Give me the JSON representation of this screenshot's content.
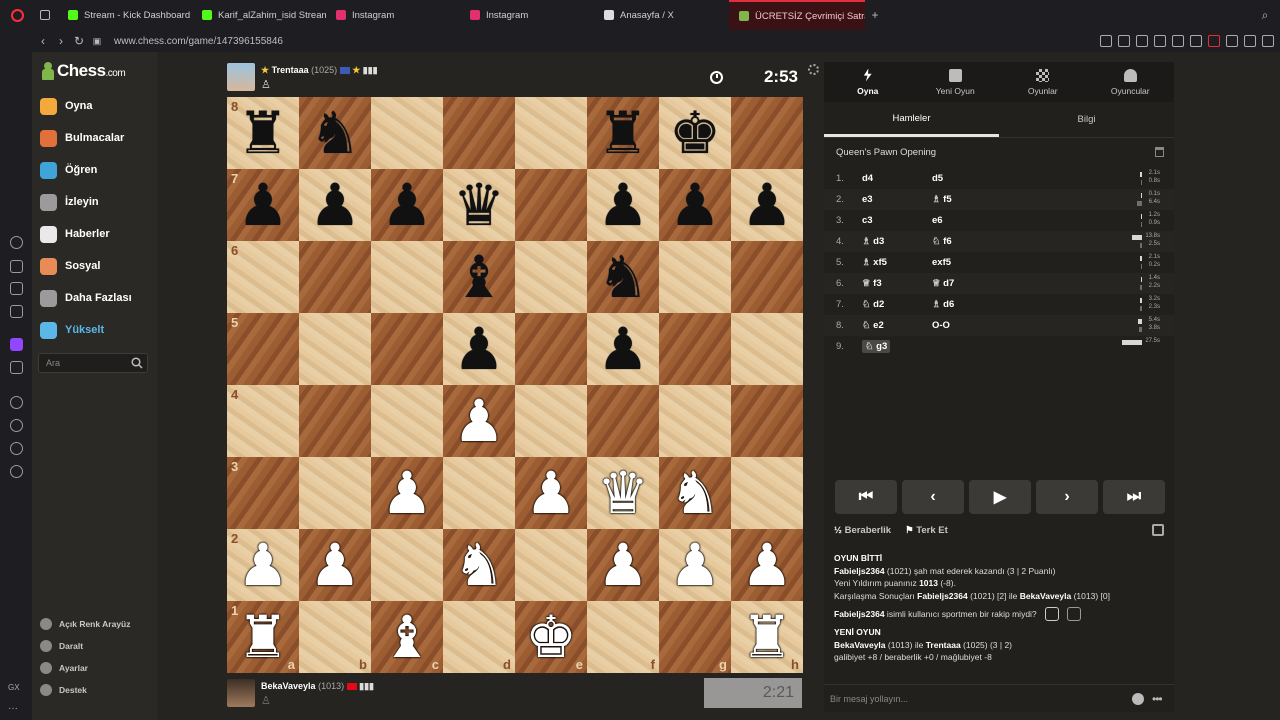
{
  "browser": {
    "tabs": [
      {
        "label": "Stream - Kick Dashboard",
        "color": "#53fc18"
      },
      {
        "label": "Karif_alZahim_isid Stream",
        "color": "#53fc18"
      },
      {
        "label": "Instagram",
        "color": "#e1306c"
      },
      {
        "label": "Instagram",
        "color": "#e1306c"
      },
      {
        "label": "Anasayfa / X",
        "color": "#dddddd"
      },
      {
        "label": "ÜCRETSİZ Çevrimiçi Satranç",
        "color": "#81b64c"
      }
    ],
    "url": "www.chess.com/game/147396155846",
    "gx_label": "GX"
  },
  "sidebar": {
    "logo": "Chess",
    "logo_suffix": ".com",
    "items": [
      {
        "label": "Oyna",
        "color": "#f3a93c"
      },
      {
        "label": "Bulmacalar",
        "color": "#e2703a"
      },
      {
        "label": "Öğren",
        "color": "#3fa4d8"
      },
      {
        "label": "İzleyin",
        "color": "#9b9b9b"
      },
      {
        "label": "Haberler",
        "color": "#e9e9e9"
      },
      {
        "label": "Sosyal",
        "color": "#e98b56"
      },
      {
        "label": "Daha Fazlası",
        "color": "#9b9b9b"
      },
      {
        "label": "Yükselt",
        "color": "#5bb7e8"
      }
    ],
    "search_placeholder": "Ara",
    "bottom": [
      "Açık Renk Arayüz",
      "Daralt",
      "Ayarlar",
      "Destek"
    ]
  },
  "game": {
    "top_player": {
      "name": "Trentaaa",
      "rating": "(1025)"
    },
    "bottom_player": {
      "name": "BekaVaveyla",
      "rating": "(1013)"
    },
    "top_clock": "2:53",
    "bottom_clock": "2:21",
    "ranks": [
      "8",
      "7",
      "6",
      "5",
      "4",
      "3",
      "2",
      "1"
    ],
    "files": [
      "a",
      "b",
      "c",
      "d",
      "e",
      "f",
      "g",
      "h"
    ],
    "board": [
      [
        "br",
        "bn",
        "",
        "",
        "",
        "br",
        "bk",
        ""
      ],
      [
        "bp",
        "bp",
        "bp",
        "bq",
        "",
        "bp",
        "bp",
        "bp"
      ],
      [
        "",
        "",
        "",
        "bb",
        "",
        "bn",
        "",
        ""
      ],
      [
        "",
        "",
        "",
        "bp",
        "",
        "bp",
        "",
        ""
      ],
      [
        "",
        "",
        "",
        "wp",
        "",
        "",
        "",
        ""
      ],
      [
        "",
        "",
        "wp",
        "",
        "wp",
        "wq",
        "wn",
        ""
      ],
      [
        "wp",
        "wp",
        "",
        "wn",
        "",
        "wp",
        "wp",
        "wp"
      ],
      [
        "wr",
        "",
        "wb",
        "",
        "wk",
        "",
        "",
        "wr"
      ]
    ]
  },
  "panel": {
    "tabs": [
      "Oyna",
      "Yeni Oyun",
      "Oyunlar",
      "Oyuncular"
    ],
    "subtabs": [
      "Hamleler",
      "Bilgi"
    ],
    "opening": "Queen's Pawn Opening",
    "moves": [
      {
        "n": "1.",
        "w": "d4",
        "b": "d5",
        "wt": "2.1s",
        "bt": "0.8s",
        "wv": 0.08,
        "bv": 0.03
      },
      {
        "n": "2.",
        "w": "e3",
        "b": "f5",
        "wt": "0.1s",
        "bt": "6.4s",
        "wv": 0.01,
        "bv": 0.23
      },
      {
        "n": "3.",
        "w": "c3",
        "b": "e6",
        "wt": "1.2s",
        "bt": "0.9s",
        "wv": 0.04,
        "bv": 0.03
      },
      {
        "n": "4.",
        "w": "d3",
        "b": "f6",
        "wt": "13.8s",
        "bt": "2.5s",
        "wv": 0.5,
        "bv": 0.09
      },
      {
        "n": "5.",
        "w": "xf5",
        "b": "exf5",
        "wt": "2.1s",
        "bt": "0.2s",
        "wv": 0.08,
        "bv": 0.01
      },
      {
        "n": "6.",
        "w": "f3",
        "b": "d7",
        "wt": "1.4s",
        "bt": "2.2s",
        "wv": 0.05,
        "bv": 0.08
      },
      {
        "n": "7.",
        "w": "d2",
        "b": "d6",
        "wt": "3.2s",
        "bt": "2.3s",
        "wv": 0.12,
        "bv": 0.08
      },
      {
        "n": "8.",
        "w": "e2",
        "b": "O-O",
        "wt": "5.4s",
        "bt": "3.8s",
        "wv": 0.2,
        "bv": 0.14
      },
      {
        "n": "9.",
        "w": "g3",
        "b": "",
        "wt": "27.5s",
        "bt": "",
        "wv": 1.0,
        "bv": 0
      }
    ],
    "actions": {
      "draw": "Beraberlik",
      "resign": "Terk Et"
    },
    "chat": {
      "header": "OYUN BİTTİ",
      "line1_name": "Fabieljs2364",
      "line1_rest": " (1021) şah mat ederek kazandı (3 | 2 Puanlı)",
      "line2_pre": "Yeni Yıldırım puanınız ",
      "line2_val": "1013",
      "line2_post": " (-8).",
      "line3_pre": "Karşılaşma Sonuçları ",
      "line3_name1": "Fabieljs2364",
      "line3_mid": " (1021) [2] ile ",
      "line3_name2": "BekaVaveyla",
      "line3_post": " (1013) [0]",
      "question_name": "Fabieljs2364",
      "question_rest": " isimli kullanıcı sportmen bir rakip miydi?",
      "new_header": "YENİ OYUN",
      "ng_name1": "BekaVaveyla",
      "ng_mid": " (1013) ile ",
      "ng_name2": "Trentaaa",
      "ng_post": " (1025) (3 | 2)",
      "stats": "galibiyet +8 / beraberlik +0 / mağlubiyet -8"
    },
    "message_placeholder": "Bir mesaj yollayın..."
  }
}
